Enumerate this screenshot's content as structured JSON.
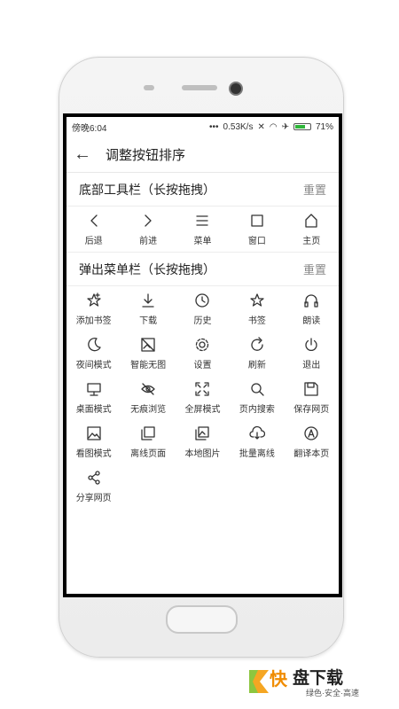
{
  "status_bar": {
    "time": "傍晚6:04",
    "speed": "0.53K/s",
    "battery": "71%",
    "battery_level": 0.71
  },
  "header": {
    "title": "调整按钮排序"
  },
  "bottom_toolbar": {
    "title": "底部工具栏（长按拖拽）",
    "reset_label": "重置",
    "items": [
      {
        "label": "后退",
        "icon": "back-icon"
      },
      {
        "label": "前进",
        "icon": "forward-icon"
      },
      {
        "label": "菜单",
        "icon": "menu-icon"
      },
      {
        "label": "窗口",
        "icon": "window-icon"
      },
      {
        "label": "主页",
        "icon": "home-icon"
      }
    ]
  },
  "popup_menu": {
    "title": "弹出菜单栏（长按拖拽）",
    "reset_label": "重置",
    "items": [
      {
        "label": "添加书签",
        "icon": "add-bookmark-icon"
      },
      {
        "label": "下载",
        "icon": "download-icon"
      },
      {
        "label": "历史",
        "icon": "history-icon"
      },
      {
        "label": "书签",
        "icon": "bookmark-icon"
      },
      {
        "label": "朗读",
        "icon": "headphones-icon"
      },
      {
        "label": "夜间模式",
        "icon": "moon-icon"
      },
      {
        "label": "智能无图",
        "icon": "no-image-icon"
      },
      {
        "label": "设置",
        "icon": "gear-icon"
      },
      {
        "label": "刷新",
        "icon": "refresh-icon"
      },
      {
        "label": "退出",
        "icon": "power-icon"
      },
      {
        "label": "桌面模式",
        "icon": "desktop-icon"
      },
      {
        "label": "无痕浏览",
        "icon": "eye-off-icon"
      },
      {
        "label": "全屏模式",
        "icon": "fullscreen-icon"
      },
      {
        "label": "页内搜索",
        "icon": "search-icon"
      },
      {
        "label": "保存网页",
        "icon": "save-icon"
      },
      {
        "label": "看图模式",
        "icon": "image-icon"
      },
      {
        "label": "离线页面",
        "icon": "offline-page-icon"
      },
      {
        "label": "本地图片",
        "icon": "local-images-icon"
      },
      {
        "label": "批量离线",
        "icon": "cloud-download-icon"
      },
      {
        "label": "翻译本页",
        "icon": "translate-icon"
      },
      {
        "label": "分享网页",
        "icon": "share-icon"
      }
    ]
  },
  "watermark": {
    "logo_char": "快",
    "title": "盘下载",
    "subtitle": "绿色·安全·高速"
  }
}
